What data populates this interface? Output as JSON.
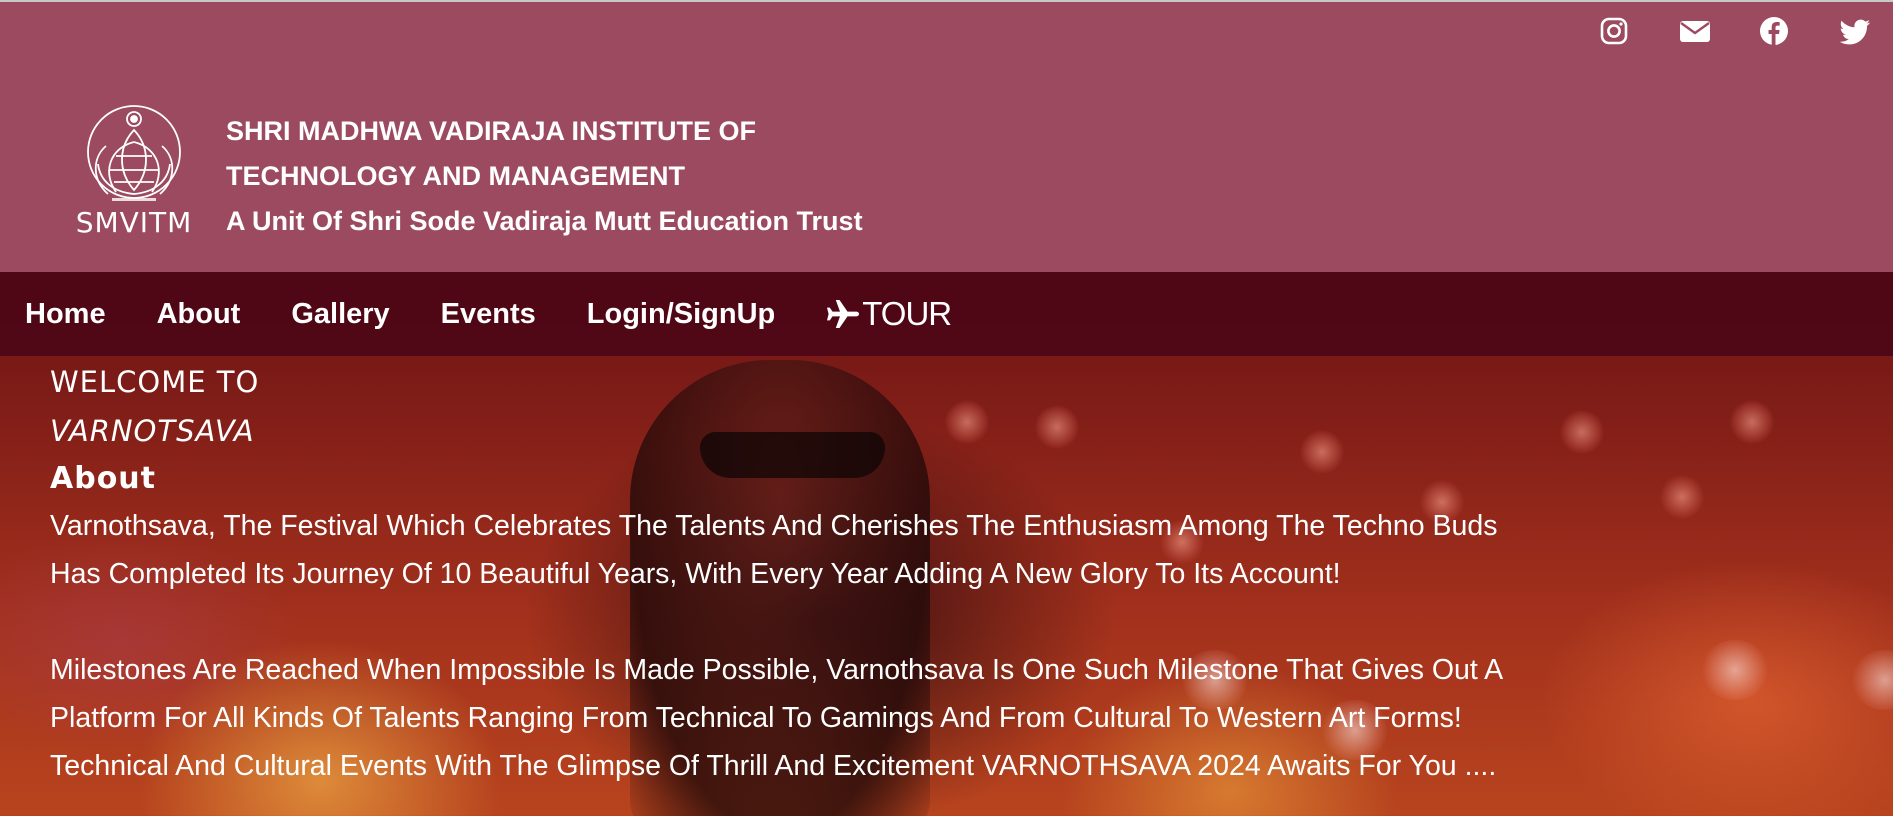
{
  "social": {
    "instagram": "instagram-icon",
    "email": "envelope-icon",
    "facebook": "facebook-icon",
    "twitter": "twitter-icon"
  },
  "brand": {
    "logo_text": "SMVITM",
    "institute_line1": "SHRI MADHWA VADIRAJA INSTITUTE OF",
    "institute_line2": "TECHNOLOGY AND MANAGEMENT",
    "trust_line": "A Unit Of Shri Sode Vadiraja Mutt Education Trust"
  },
  "nav": {
    "items": [
      "Home",
      "About",
      "Gallery",
      "Events",
      "Login/SignUp"
    ],
    "tour_label": "TOUR"
  },
  "hero": {
    "welcome": "WELCOME TO",
    "fest_name": "VARNOTSAVA",
    "about_heading": "About",
    "para1_line1": "Varnothsava, The Festival Which Celebrates The Talents And Cherishes The Enthusiasm Among The Techno Buds",
    "para1_line2": "Has Completed Its Journey Of 10 Beautiful Years, With Every Year Adding A New Glory To Its Account!",
    "para2_line1": "Milestones Are Reached When Impossible Is Made Possible, Varnothsava Is One Such Milestone That Gives Out A",
    "para2_line2": "Platform For All Kinds Of Talents Ranging From Technical To Gamings And From Cultural To Western Art Forms!",
    "para2_line3": "Technical And Cultural Events With The Glimpse Of Thrill And Excitement VARNOTHSAVA 2024 Awaits For You ...."
  },
  "colors": {
    "header_bg": "#9c4a5f",
    "nav_bg": "#4b0616",
    "text": "#ffffff"
  }
}
